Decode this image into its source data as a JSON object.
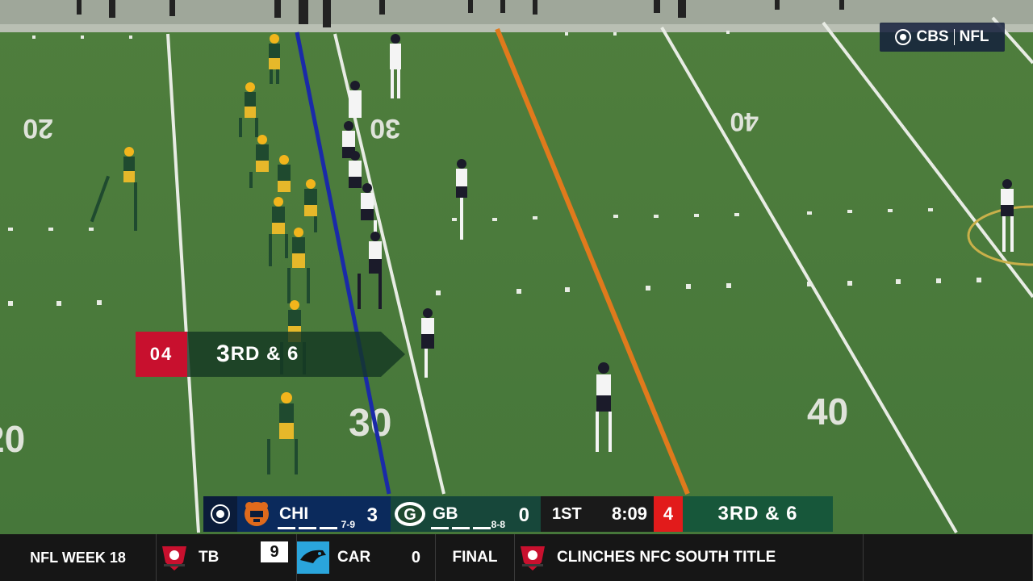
{
  "network_bug": {
    "network": "CBS",
    "league": "NFL"
  },
  "yard_numbers": [
    "20",
    "30",
    "40",
    "30",
    "40",
    "20"
  ],
  "down_marker": {
    "play_clock": "04",
    "down_distance_prefix": "3",
    "down_distance_suffix": "RD & 6"
  },
  "scorebug": {
    "away": {
      "abbr": "CHI",
      "score": "3",
      "record": "7-9",
      "color": "#0b2a5c"
    },
    "home": {
      "abbr": "GB",
      "score": "0",
      "record": "8-8",
      "color": "#17473a"
    },
    "quarter": "1ST",
    "clock": "8:09",
    "play_clock": "4",
    "down_distance": "3RD & 6"
  },
  "ticker": {
    "week": "NFL WEEK 18",
    "team1": {
      "abbr": "TB",
      "score": "9"
    },
    "team2": {
      "abbr": "CAR",
      "score": "0"
    },
    "status": "FINAL",
    "headline": "CLINCHES NFC SOUTH TITLE"
  },
  "colors": {
    "line_of_scrimmage": "#1a2aa8",
    "first_down_line": "#e07a1c",
    "field": "#4a7a3a"
  }
}
